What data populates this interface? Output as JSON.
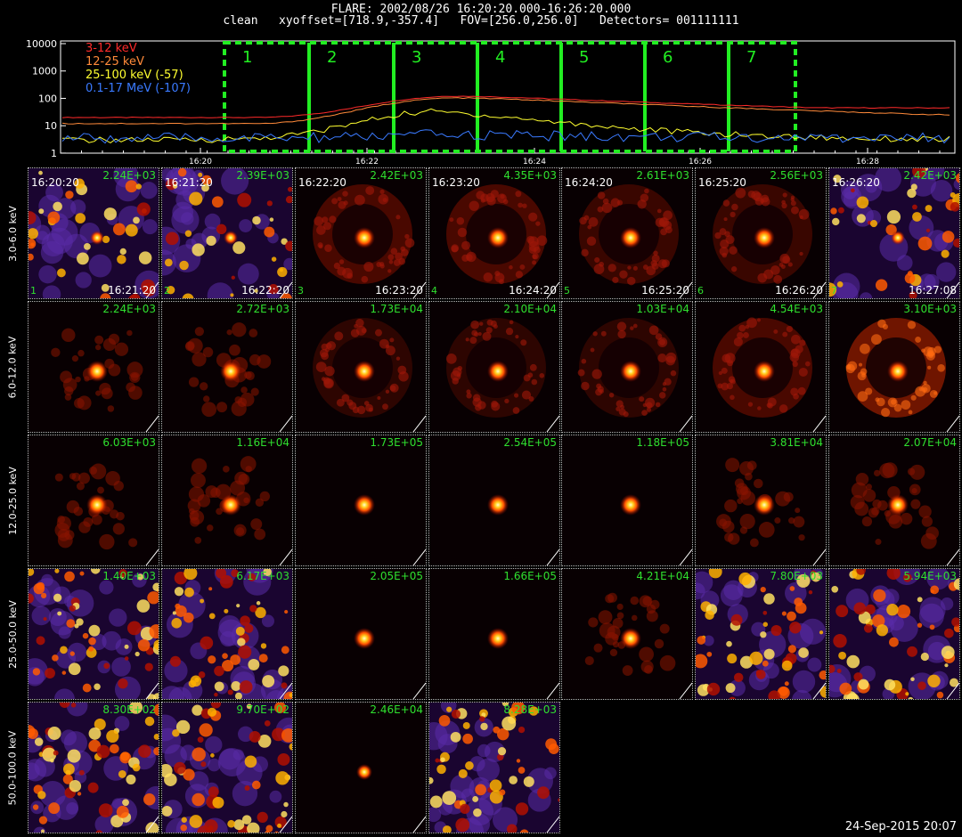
{
  "header": {
    "line1": "FLARE: 2002/08/26 16:20:20.000-16:26:20.000",
    "line2": "clean   xyoffset=[718.9,-357.4]   FOV=[256.0,256.0]   Detectors= 001111111"
  },
  "lightcurve": {
    "y_ticks": [
      "10000",
      "1000",
      "100",
      "10",
      "1"
    ],
    "x_ticks": [
      "16:20",
      "16:22",
      "16:24",
      "16:26",
      "16:28"
    ],
    "legend": [
      {
        "label": "3-12 keV",
        "color": "#ff2a2a"
      },
      {
        "label": "12-25 keV",
        "color": "#ff8a3a"
      },
      {
        "label": "25-100 keV (-57)",
        "color": "#ffff30"
      },
      {
        "label": "0.1-17 MeV (-107)",
        "color": "#3a7aff"
      }
    ],
    "intervals": [
      "1",
      "2",
      "3",
      "4",
      "5",
      "6",
      "7"
    ],
    "interval_color": "#22ee22"
  },
  "row_labels": [
    "3.0-6.0 keV",
    "6.0-12.0 keV",
    "12.0-25.0 keV",
    "25.0-50.0 keV",
    "50.0-100.0 keV"
  ],
  "times_start": [
    "16:20:20",
    "16:21:20",
    "16:22:20",
    "16:23:20",
    "16:24:20",
    "16:25:20",
    "16:26:20"
  ],
  "times_end": [
    "16:21:20",
    "16:22:20",
    "16:23:20",
    "16:24:20",
    "16:25:20",
    "16:26:20",
    "16:27:08"
  ],
  "tile_numbers": [
    "1",
    "2",
    "3",
    "4",
    "5",
    "6",
    "7"
  ],
  "maxima": [
    [
      "2.24E+03",
      "2.39E+03",
      "2.42E+03",
      "4.35E+03",
      "2.61E+03",
      "2.56E+03",
      "2.42E+03"
    ],
    [
      "2.24E+03",
      "2.72E+03",
      "1.73E+04",
      "2.10E+04",
      "1.03E+04",
      "4.54E+03",
      "3.10E+03"
    ],
    [
      "6.03E+03",
      "1.16E+04",
      "1.73E+05",
      "2.54E+05",
      "1.18E+05",
      "3.81E+04",
      "2.07E+04"
    ],
    [
      "1.40E+03",
      "6.17E+03",
      "2.05E+05",
      "1.66E+05",
      "4.21E+04",
      "7.80E+03",
      "5.94E+03"
    ],
    [
      "8.30E+02",
      "9.70E+02",
      "2.46E+04",
      "8.28E+03"
    ]
  ],
  "timestamp": "24-Sep-2015 20:07"
}
